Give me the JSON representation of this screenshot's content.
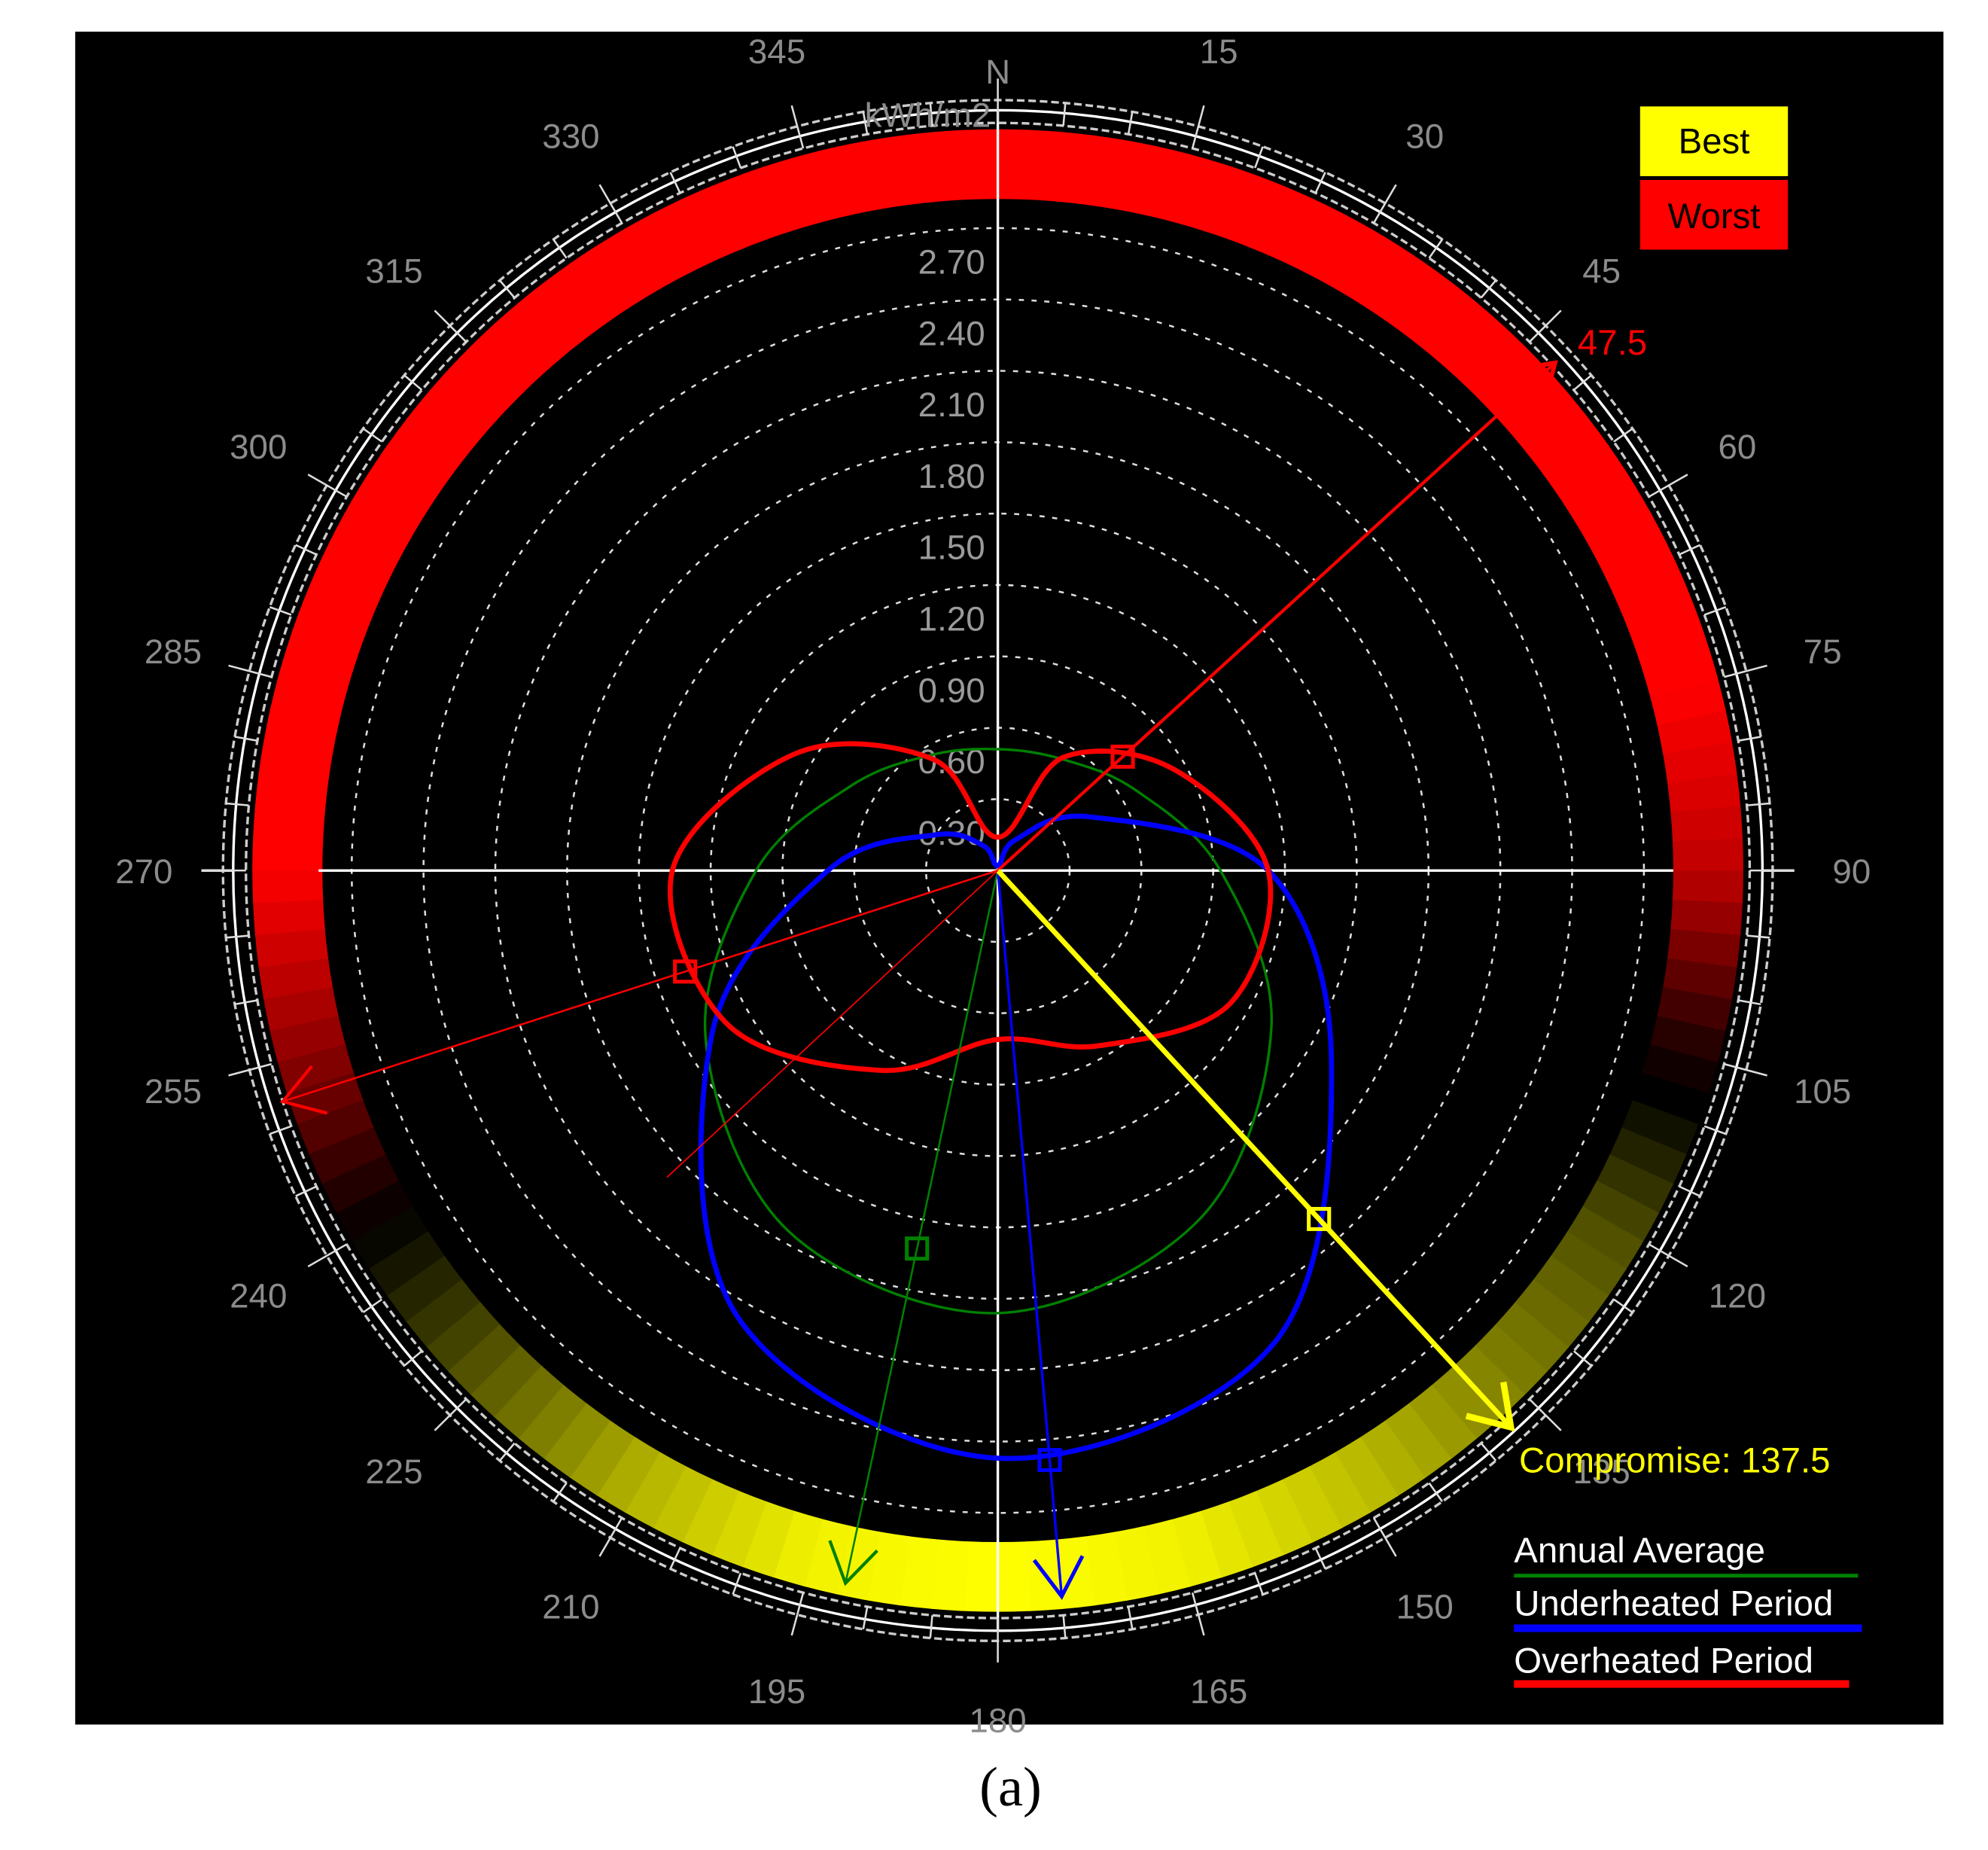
{
  "chart_data": {
    "type": "polar-line",
    "unit_label": "kWh/m2",
    "north_label": "N",
    "radial_range": [
      0,
      2.7
    ],
    "radial_ticks": [
      "0.30",
      "0.60",
      "0.90",
      "1.20",
      "1.50",
      "1.80",
      "2.10",
      "2.40",
      "2.70"
    ],
    "angle_ticks": [
      "N",
      "15",
      "30",
      "45",
      "60",
      "75",
      "90",
      "105",
      "120",
      "135",
      "150",
      "165",
      "180",
      "195",
      "210",
      "225",
      "240",
      "255",
      "270",
      "285",
      "300",
      "315",
      "330",
      "345"
    ],
    "azimuths": [
      0,
      30,
      60,
      90,
      120,
      150,
      180,
      210,
      240,
      270,
      300,
      330
    ],
    "series": [
      {
        "name": "Annual Average",
        "color": "#008000",
        "values": [
          0.51,
          0.54,
          0.67,
          0.93,
          1.32,
          1.69,
          1.86,
          1.75,
          1.41,
          1.01,
          0.71,
          0.56
        ],
        "marker_azimuth": 192
      },
      {
        "name": "Underheated Period",
        "color": "#0000ff",
        "values": [
          0.02,
          0.15,
          0.45,
          1.13,
          1.61,
          2.3,
          2.47,
          2.17,
          1.38,
          0.71,
          0.3,
          0.12
        ],
        "marker_azimuth": 175
      },
      {
        "name": "Overheated Period",
        "color": "#ff0000",
        "values": [
          0.14,
          0.55,
          0.85,
          1.13,
          1.12,
          0.85,
          0.71,
          0.97,
          1.3,
          1.36,
          0.98,
          0.54
        ],
        "marker_azimuth": 47.5
      }
    ],
    "band": {
      "azimuths": [
        0,
        15,
        30,
        45,
        60,
        75,
        90,
        105,
        120,
        135,
        150,
        165,
        180,
        195,
        210,
        225,
        240,
        255,
        270,
        285,
        300,
        315,
        330,
        345
      ],
      "scores": [
        -1,
        -1,
        -1,
        -1,
        -1,
        -1,
        -0.75,
        -0.1,
        0.3,
        0.5,
        0.75,
        0.95,
        1,
        0.95,
        0.7,
        0.35,
        0,
        -0.55,
        -1,
        -1,
        -1,
        -1,
        -1,
        -1
      ]
    },
    "key": {
      "best": "Best",
      "worst": "Worst",
      "best_color": "#ffff00",
      "worst_color": "#ff0000"
    },
    "worst_orientation": {
      "label": "47.5",
      "azimuth": 47.5
    },
    "compromise": {
      "label": "Compromise: 137.5",
      "azimuth": 137.5
    },
    "legend_position": "bottom-right"
  },
  "caption": "(a)"
}
